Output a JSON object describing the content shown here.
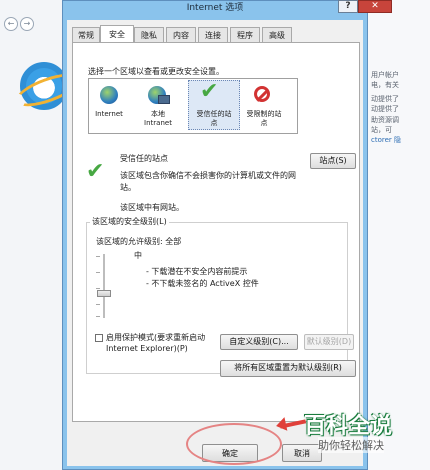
{
  "window": {
    "title": "Internet 选项",
    "help": "?",
    "close": "✕"
  },
  "tabs": [
    {
      "label": "常规"
    },
    {
      "label": "安全"
    },
    {
      "label": "隐私"
    },
    {
      "label": "内容"
    },
    {
      "label": "连接"
    },
    {
      "label": "程序"
    },
    {
      "label": "高级"
    }
  ],
  "active_tab": "安全",
  "security": {
    "instruction": "选择一个区域以查看或更改安全设置。",
    "zones": [
      {
        "line1": "Internet",
        "line2": "",
        "icon": "globe-icon"
      },
      {
        "line1": "本地",
        "line2": "Intranet",
        "icon": "intranet-icon"
      },
      {
        "line1": "受信任的站",
        "line2": "点",
        "icon": "checkmark-icon"
      },
      {
        "line1": "受限制的站",
        "line2": "点",
        "icon": "restricted-icon"
      }
    ],
    "selected_zone": {
      "name": "受信任的站点",
      "desc1": "该区域包含你确信不会损害你的计算机或文件的网",
      "desc2": "站。",
      "desc3": "该区域中有网站。"
    },
    "sites_button": "站点(S)",
    "level_group": "该区域的安全级别(L)",
    "allowed_levels": "该区域的允许级别: 全部",
    "level_name": "中",
    "bullets": [
      "- 下载潜在不安全内容前提示",
      "- 不下载未签名的 ActiveX 控件"
    ],
    "protected_mode_line1": "启用保护模式(要求重新启动",
    "protected_mode_line2": "Internet Explorer)(P)",
    "protected_mode_checked": false,
    "custom_level_button": "自定义级别(C)...",
    "default_level_button": "默认级别(D)",
    "reset_all_button": "将所有区域重置为默认级别(R)"
  },
  "footer": {
    "ok": "确定",
    "cancel": "取消"
  },
  "background": {
    "right_lines": [
      "用户帐户",
      "电，有关",
      "动提供了",
      "动提供了",
      "助资源调",
      "站，可",
      "ctorer 隐"
    ],
    "nav_back": "←",
    "nav_forward": "→"
  },
  "watermark": {
    "title": "百科全说",
    "subtitle": "助你轻松解决"
  },
  "colors": {
    "title_bar": "#8ac3ec",
    "close": "#c7443b",
    "annotation": "#e0403a",
    "check": "#47a843"
  }
}
